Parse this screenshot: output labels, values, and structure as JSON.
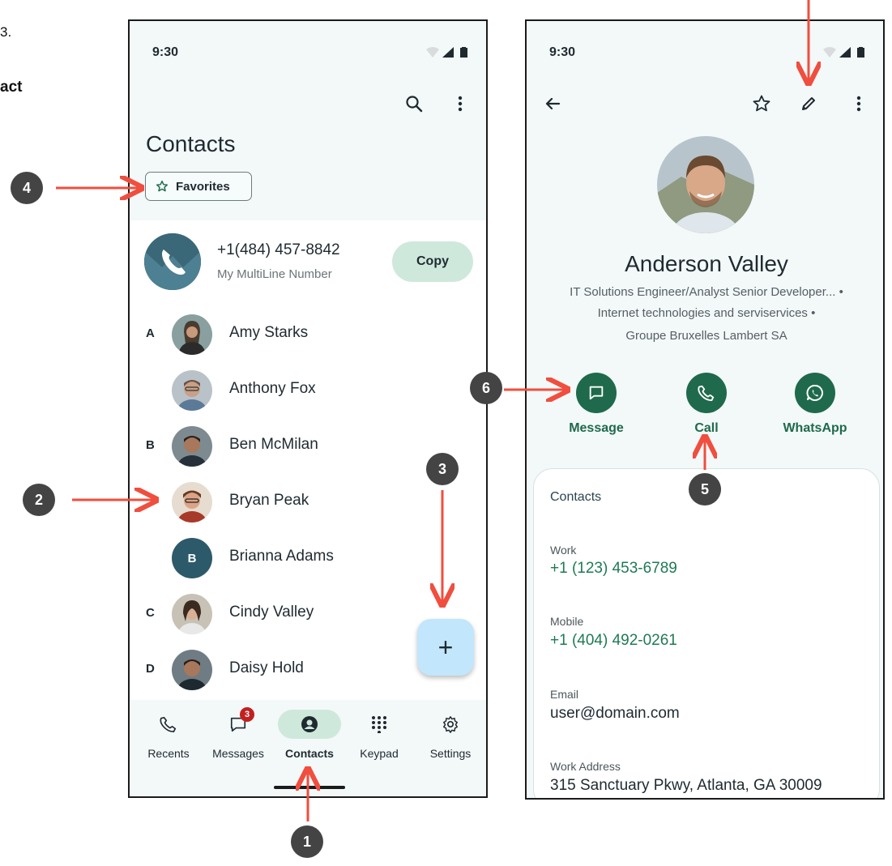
{
  "page_fragments": {
    "line1": "3.",
    "line2": "act"
  },
  "left_screen": {
    "status_time": "9:30",
    "title": "Contacts",
    "favorites_chip": "Favorites",
    "multiline": {
      "number": "+1(484) 457-8842",
      "label": "My MultiLine Number",
      "copy_label": "Copy"
    },
    "contacts": [
      {
        "letter": "A",
        "name": "Amy Starks",
        "avatar_color": "#6b5a4a"
      },
      {
        "letter": "",
        "name": "Anthony Fox",
        "avatar_color": "#8a8f96"
      },
      {
        "letter": "B",
        "name": "Ben McMilan",
        "avatar_color": "#4f5a66"
      },
      {
        "letter": "",
        "name": "Bryan Peak",
        "avatar_color": "#b07a5c"
      },
      {
        "letter": "",
        "name": "Brianna Adams",
        "initial": "B",
        "avatar_color": "#2d5a6a"
      },
      {
        "letter": "C",
        "name": "Cindy Valley",
        "avatar_color": "#9a8c7a"
      },
      {
        "letter": "D",
        "name": "Daisy Hold",
        "avatar_color": "#4a5560"
      }
    ],
    "fab_label": "+",
    "nav": [
      {
        "label": "Recents",
        "icon": "phone-icon"
      },
      {
        "label": "Messages",
        "icon": "chat-icon",
        "badge": "3"
      },
      {
        "label": "Contacts",
        "icon": "person-icon",
        "active": true
      },
      {
        "label": "Keypad",
        "icon": "dialpad-icon"
      },
      {
        "label": "Settings",
        "icon": "gear-icon"
      }
    ]
  },
  "right_screen": {
    "status_time": "9:30",
    "name": "Anderson Valley",
    "info_lines": [
      "IT Solutions Engineer/Analyst Senior Developer... •",
      "Internet technologies and serviservices •",
      "Groupe Bruxelles Lambert SA"
    ],
    "actions": [
      {
        "label": "Message",
        "icon": "message-icon"
      },
      {
        "label": "Call",
        "icon": "phone-icon"
      },
      {
        "label": "WhatsApp",
        "icon": "whatsapp-icon"
      }
    ],
    "card": {
      "title": "Contacts",
      "fields": [
        {
          "label": "Work",
          "value": "+1 (123) 453-6789"
        },
        {
          "label": "Mobile",
          "value": "+1 (404) 492-0261"
        },
        {
          "label": "Email",
          "value": "user@domain.com"
        },
        {
          "label": "Work Address",
          "value": "315 Sanctuary Pkwy, Atlanta, GA 30009"
        }
      ]
    }
  },
  "callouts": [
    "1",
    "2",
    "3",
    "4",
    "5",
    "6"
  ],
  "colors": {
    "accent_green": "#1f6a4c",
    "arrow_red": "#f04e3e",
    "callout_gray": "#444444",
    "fab_blue": "#c2e6fb",
    "copy_green": "#cfe8dc"
  }
}
